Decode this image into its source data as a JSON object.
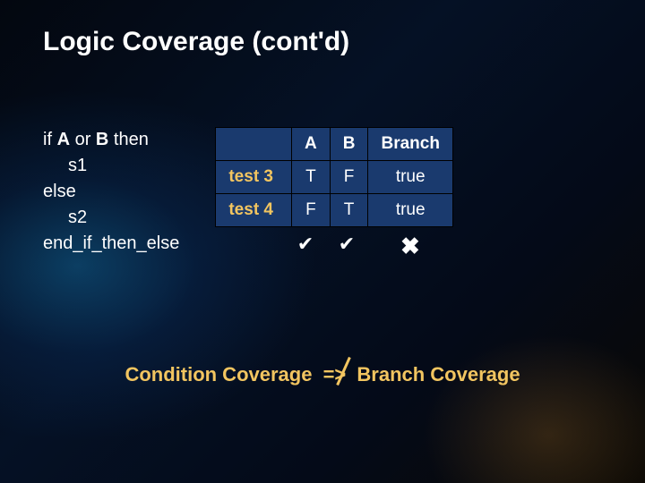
{
  "title": "Logic Coverage (cont'd)",
  "code": {
    "l1a": "if ",
    "l1b": "A",
    "l1c": " or ",
    "l1d": "B",
    "l1e": " then",
    "l2": "s1",
    "l3": "else",
    "l4": "s2",
    "l5": "end_if_then_else"
  },
  "table": {
    "headers": {
      "blank": "",
      "A": "A",
      "B": "B",
      "Branch": "Branch"
    },
    "rows": [
      {
        "label": "test 3",
        "A": "T",
        "B": "F",
        "Branch": "true"
      },
      {
        "label": "test 4",
        "A": "F",
        "B": "T",
        "Branch": "true"
      }
    ],
    "marks": {
      "A": "✔",
      "B": "✔",
      "Branch": "✖"
    }
  },
  "conclusion": {
    "left": "Condition Coverage ",
    "arrow": "=>",
    "right": " Branch Coverage"
  }
}
